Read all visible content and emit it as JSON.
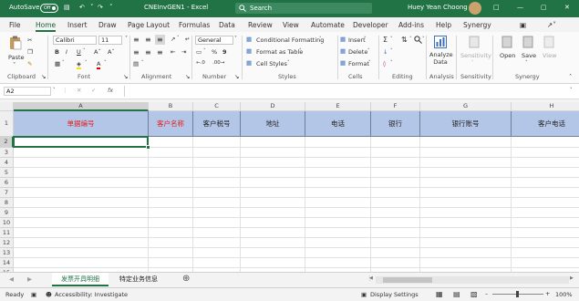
{
  "titlebar": {
    "autosave_label": "AutoSave",
    "autosave_state": "Off",
    "doc_title": "CNEInvGEN1  -  Excel",
    "search_placeholder": "Search",
    "user_name": "Huey Yean Choong"
  },
  "menu": {
    "tabs": [
      "File",
      "Home",
      "Insert",
      "Draw",
      "Page Layout",
      "Formulas",
      "Data",
      "Review",
      "View",
      "Automate",
      "Developer",
      "Add-ins",
      "Help",
      "Synergy"
    ],
    "active": "Home"
  },
  "ribbon": {
    "clipboard": {
      "paste": "Paste",
      "label": "Clipboard"
    },
    "font": {
      "name": "Calibri",
      "size": "11",
      "label": "Font"
    },
    "alignment": {
      "label": "Alignment"
    },
    "number": {
      "format": "General",
      "label": "Number"
    },
    "styles": {
      "conditional": "Conditional Formatting",
      "format_table": "Format as Table",
      "cell_styles": "Cell Styles",
      "label": "Styles"
    },
    "cells": {
      "insert": "Insert",
      "delete": "Delete",
      "format": "Format",
      "label": "Cells"
    },
    "editing": {
      "label": "Editing"
    },
    "analysis": {
      "analyze": "Analyze Data",
      "label": "Analysis"
    },
    "sensitivity": {
      "btn": "Sensitivity",
      "label": "Sensitivity"
    },
    "synergy": {
      "open": "Open",
      "save": "Save",
      "view": "View",
      "label": "Synergy"
    }
  },
  "formula_bar": {
    "name_box": "A2",
    "fx": "fx",
    "formula": ""
  },
  "sheet": {
    "columns": [
      "A",
      "B",
      "C",
      "D",
      "E",
      "F",
      "G",
      "H"
    ],
    "rows": [
      "1",
      "2",
      "3",
      "4",
      "5",
      "6",
      "7",
      "8",
      "9",
      "10",
      "11",
      "12",
      "13",
      "14",
      "15"
    ],
    "headers": [
      "单据编号",
      "客户名称",
      "客户税号",
      "地址",
      "电话",
      "银行",
      "银行账号",
      "客户电话"
    ],
    "header_red": [
      "单据编号",
      "客户名称"
    ],
    "selected_cell": "A2"
  },
  "sheet_tabs": {
    "tabs": [
      "发票开具明细",
      "特定业务信息"
    ],
    "active": "发票开具明细"
  },
  "status": {
    "ready": "Ready",
    "accessibility": "Accessibility: Investigate",
    "display_settings": "Display Settings",
    "zoom": "100%"
  },
  "colors": {
    "brand": "#217346",
    "header_fill": "#b4c6e7",
    "red_text": "#e02020"
  }
}
